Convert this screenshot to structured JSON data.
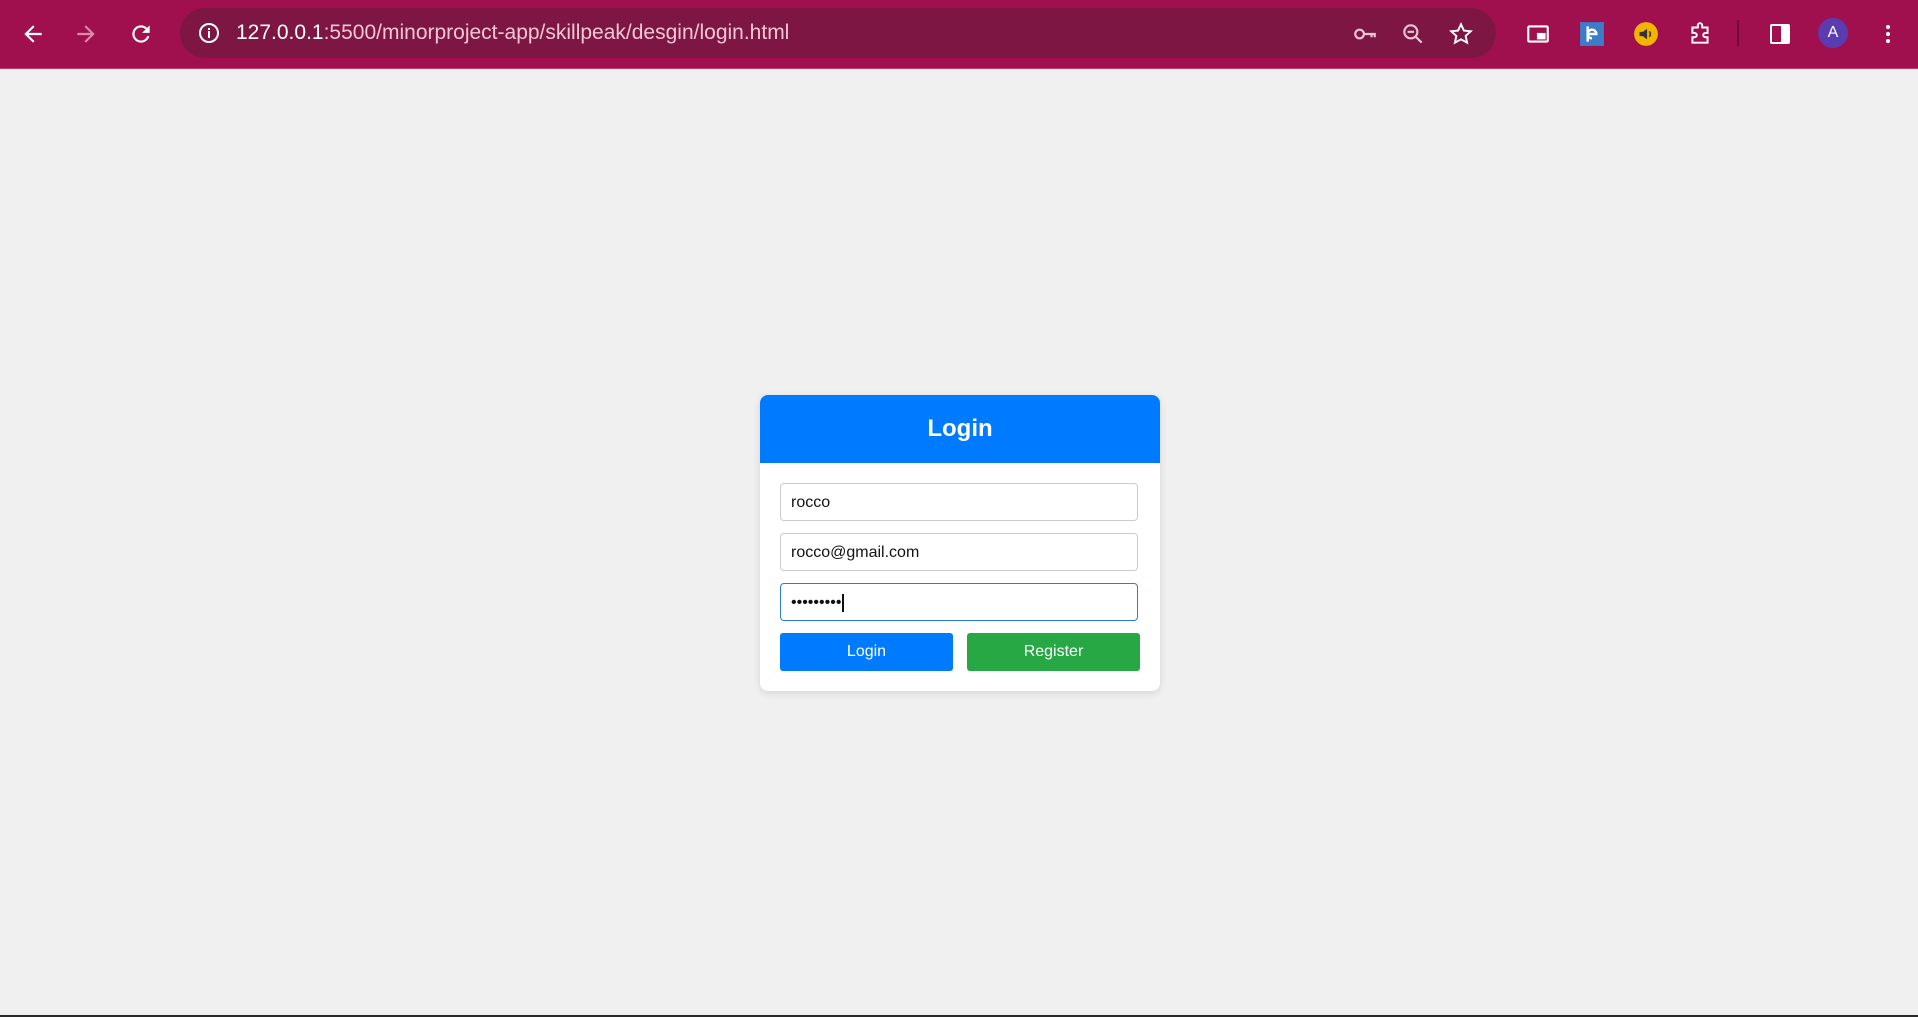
{
  "browser": {
    "url_host": "127.0.0.1",
    "url_path": ":5500/minorproject-app/skillpeak/desgin/login.html",
    "profile_initial": "A",
    "icons": {
      "back": "arrow-left-icon",
      "forward": "arrow-right-icon",
      "reload": "reload-icon",
      "site_info": "info-icon",
      "password_key": "key-icon",
      "zoom": "zoom-out-icon",
      "bookmark": "star-icon",
      "picture_in_picture": "pip-icon",
      "extension_e": "extension-e-icon",
      "extension_audio": "speaker-icon",
      "extensions": "puzzle-icon",
      "side_panel": "side-panel-icon",
      "menu": "kebab-menu-icon"
    },
    "colors": {
      "frame": "#a0104e",
      "omnibox": "#7e1644"
    }
  },
  "login": {
    "title": "Login",
    "username_value": "rocco",
    "email_value": "rocco@gmail.com",
    "password_mask": "•••••••••",
    "login_label": "Login",
    "register_label": "Register",
    "colors": {
      "header": "#007bff",
      "login_button": "#007bff",
      "register_button": "#28a745",
      "page_bg": "#f0f0f0"
    }
  }
}
